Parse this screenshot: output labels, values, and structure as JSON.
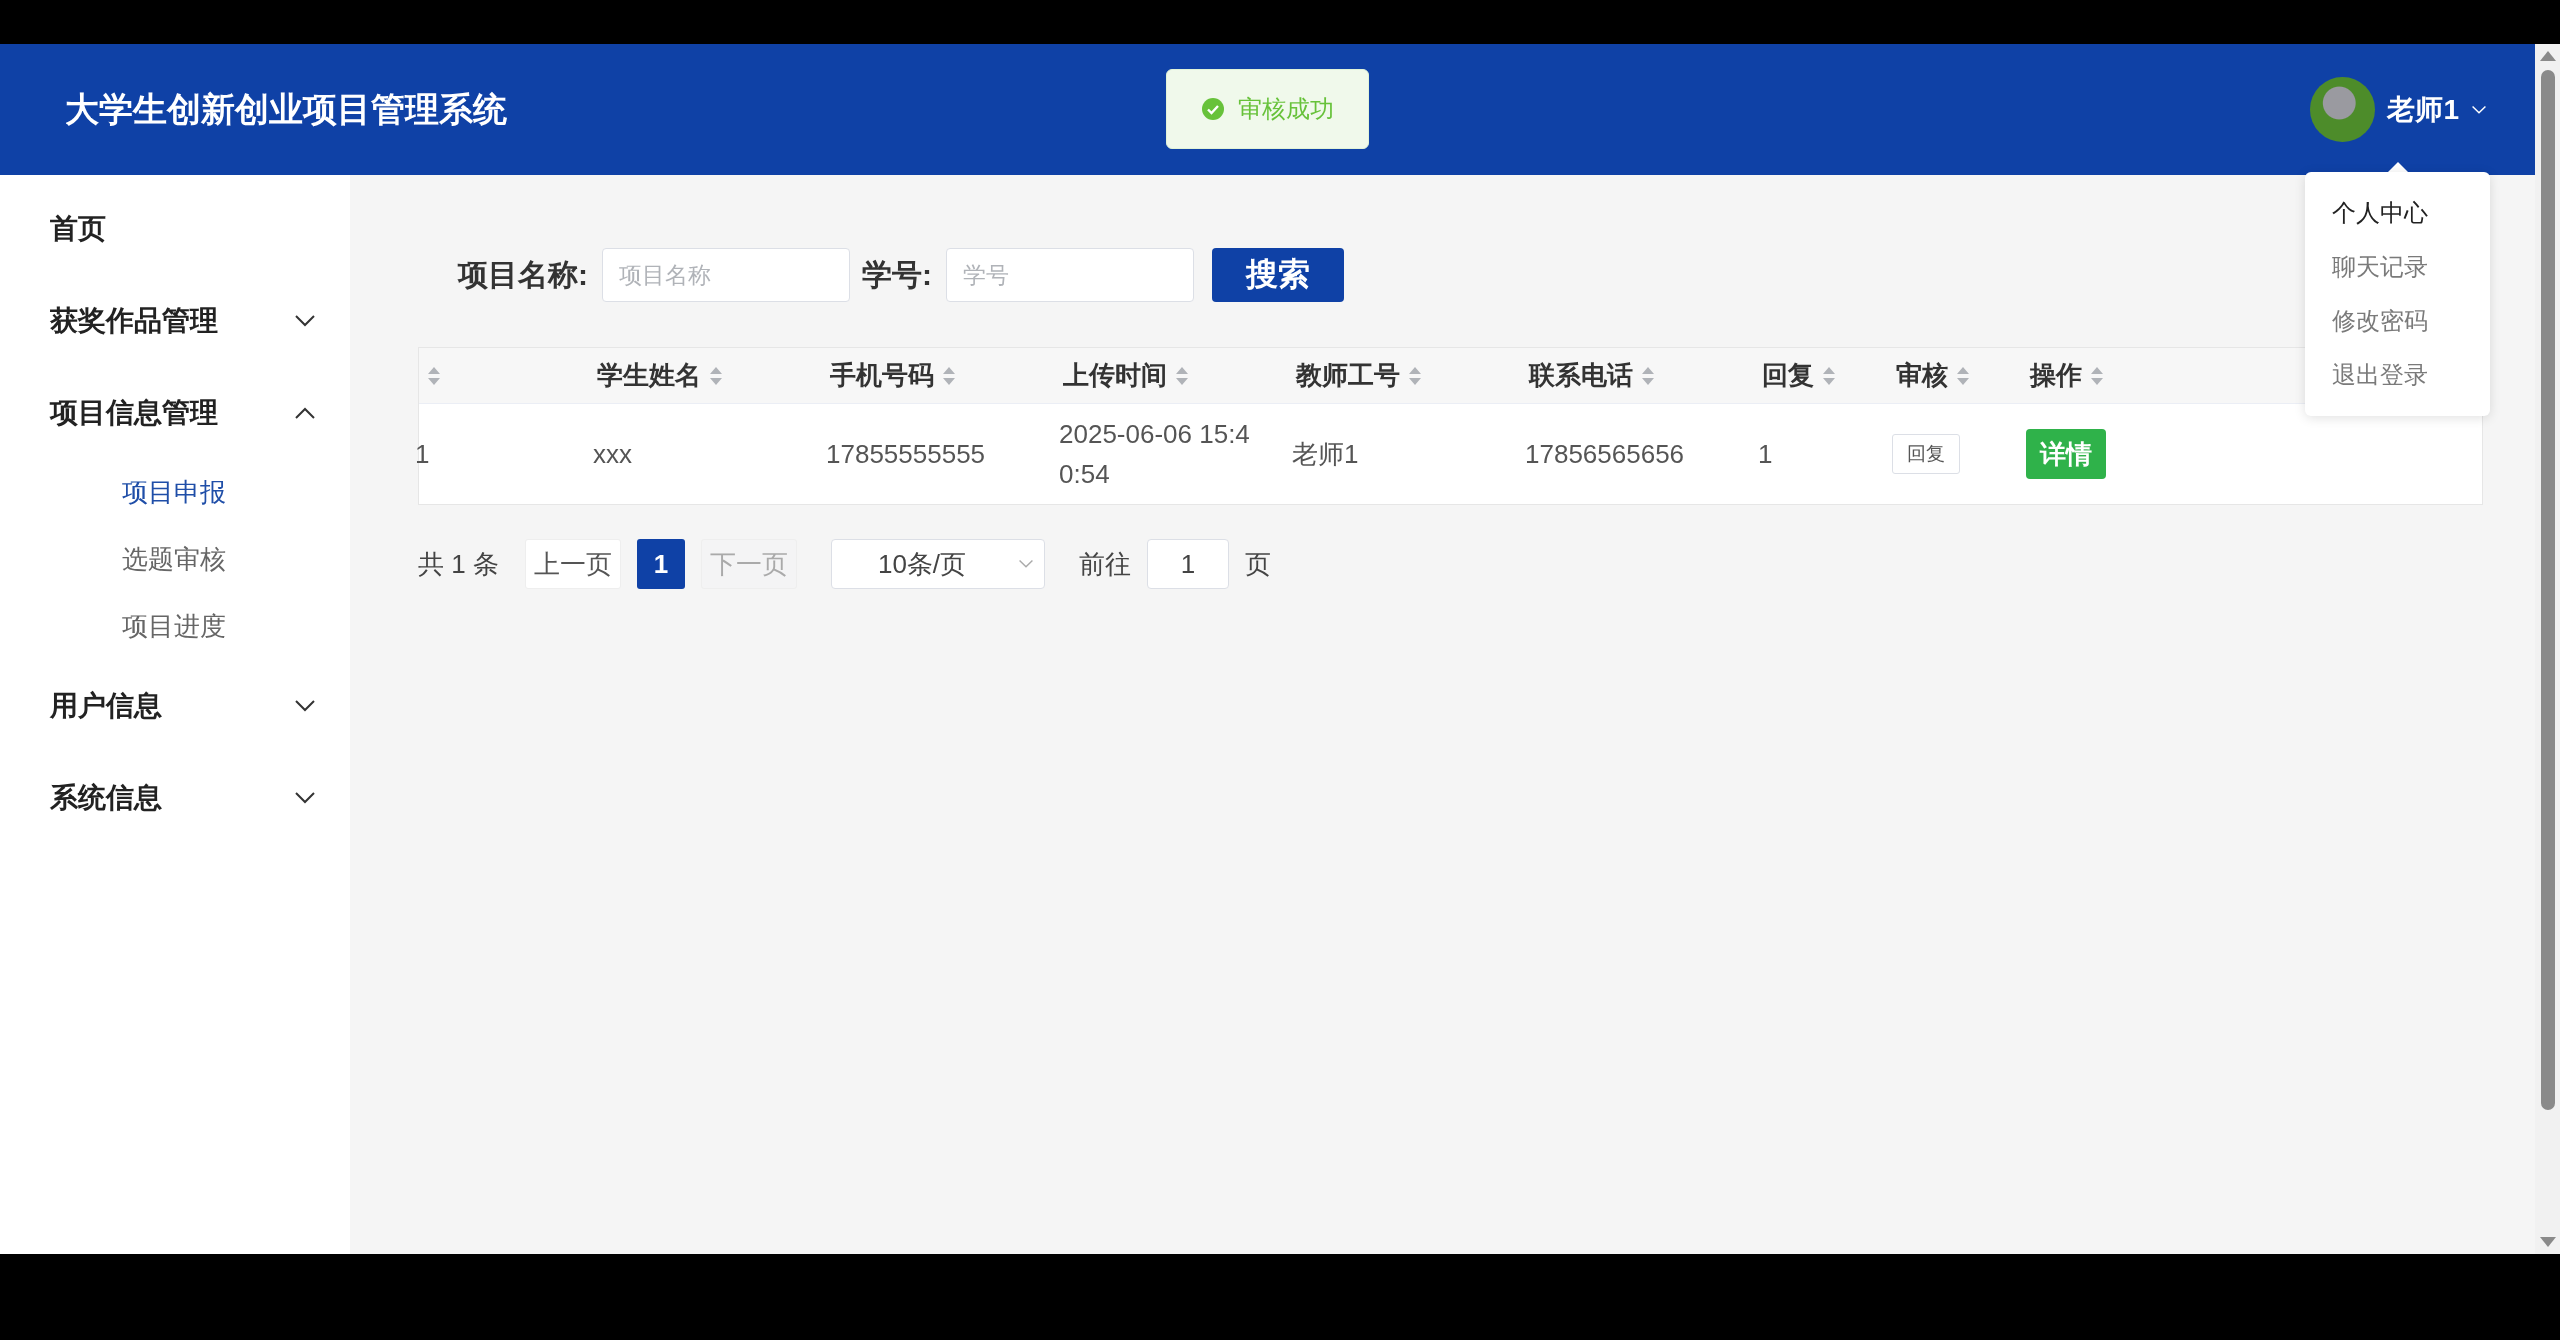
{
  "header": {
    "title": "大学生创新创业项目管理系统",
    "user": {
      "name": "老师1"
    }
  },
  "toast": {
    "kind": "success",
    "message": "审核成功"
  },
  "user_menu": {
    "items": [
      {
        "label": "个人中心",
        "selected": true
      },
      {
        "label": "聊天记录",
        "selected": false
      },
      {
        "label": "修改密码",
        "selected": false
      },
      {
        "label": "退出登录",
        "selected": false
      }
    ]
  },
  "sidebar": {
    "items": [
      {
        "label": "首页"
      },
      {
        "label": "获奖作品管理",
        "expanded": false
      },
      {
        "label": "项目信息管理",
        "expanded": true,
        "children": [
          {
            "label": "项目申报",
            "selected": true
          },
          {
            "label": "选题审核",
            "selected": false
          },
          {
            "label": "项目进度",
            "selected": false
          }
        ]
      },
      {
        "label": "用户信息",
        "expanded": false
      },
      {
        "label": "系统信息",
        "expanded": false
      }
    ]
  },
  "search": {
    "fields": [
      {
        "label": "项目名称:",
        "placeholder": "项目名称"
      },
      {
        "label": "学号:",
        "placeholder": "学号"
      }
    ],
    "button": "搜索"
  },
  "table": {
    "columns": [
      {
        "kind": "blank"
      },
      {
        "kind": "text",
        "label": "学生姓名"
      },
      {
        "kind": "text",
        "label": "手机号码"
      },
      {
        "kind": "text",
        "label": "上传时间"
      },
      {
        "kind": "text",
        "label": "教师工号"
      },
      {
        "kind": "text",
        "label": "联系电话"
      },
      {
        "kind": "text",
        "label": "回复"
      },
      {
        "kind": "text",
        "label": "审核"
      },
      {
        "kind": "text",
        "label": "操作"
      }
    ],
    "rows": [
      {
        "cells": [
          {
            "kind": "text",
            "text": "1"
          },
          {
            "kind": "text",
            "text": "xxx"
          },
          {
            "kind": "text",
            "text": "17855555555"
          },
          {
            "kind": "text",
            "text": "2025-06-06 15:40:54"
          },
          {
            "kind": "text",
            "text": "老师1"
          },
          {
            "kind": "text",
            "text": "17856565656"
          },
          {
            "kind": "text",
            "text": "1"
          },
          {
            "kind": "plain_button",
            "text": "回复"
          },
          {
            "kind": "success_button",
            "text": "详情"
          }
        ]
      }
    ]
  },
  "pagination": {
    "total": "共 1 条",
    "prev": {
      "label": "上一页",
      "disabled": false
    },
    "pages": [
      {
        "label": "1",
        "selected": true
      }
    ],
    "next": {
      "label": "下一页",
      "disabled": true
    },
    "page_size": "10条/页",
    "goto_label": "前往",
    "goto_value": "1",
    "goto_suffix": "页"
  }
}
